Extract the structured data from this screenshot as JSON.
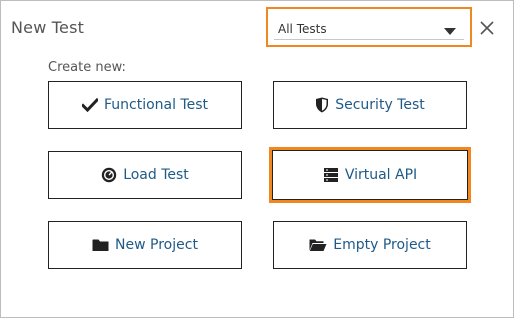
{
  "dialog": {
    "title": "New Test",
    "filter": {
      "selected": "All Tests"
    },
    "create_label": "Create new:",
    "tiles": [
      {
        "label": "Functional Test",
        "icon": "checkmark-icon"
      },
      {
        "label": "Security Test",
        "icon": "shield-icon"
      },
      {
        "label": "Load Test",
        "icon": "gauge-icon"
      },
      {
        "label": "Virtual API",
        "icon": "server-icon",
        "selected": true
      },
      {
        "label": "New Project",
        "icon": "folder-icon"
      },
      {
        "label": "Empty Project",
        "icon": "folder-open-icon"
      }
    ]
  },
  "colors": {
    "accent": "#f0871f",
    "link": "#1f5a87",
    "text": "#555555"
  }
}
